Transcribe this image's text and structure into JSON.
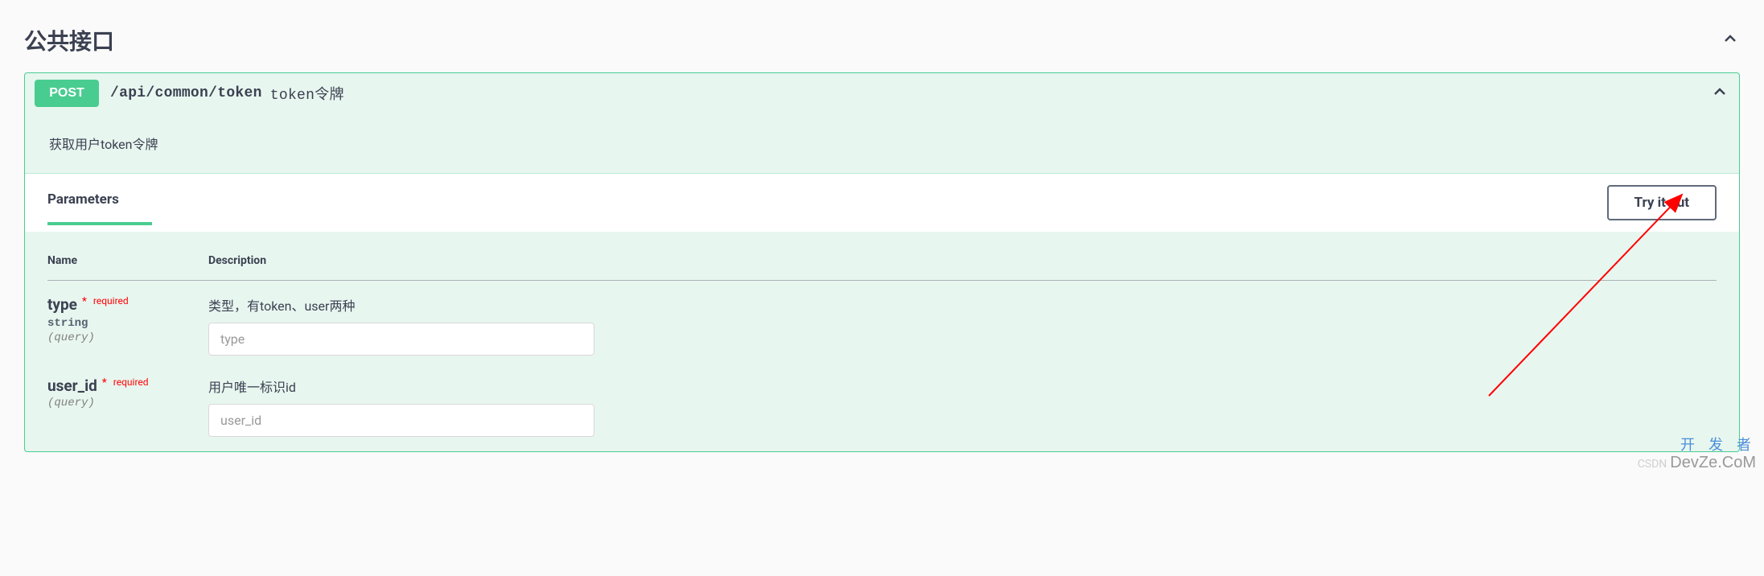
{
  "section": {
    "title": "公共接口"
  },
  "operation": {
    "method": "POST",
    "path": "/api/common/token",
    "summary": "token令牌",
    "description": "获取用户token令牌"
  },
  "paramsSection": {
    "title": "Parameters",
    "tryButton": "Try it out",
    "headers": {
      "name": "Name",
      "description": "Description"
    }
  },
  "parameters": [
    {
      "name": "type",
      "requiredLabel": "required",
      "type": "string",
      "in": "(query)",
      "description": "类型，有token、user两种",
      "placeholder": "type"
    },
    {
      "name": "user_id",
      "requiredLabel": "required",
      "type": "",
      "in": "(query)",
      "description": "用户唯一标识id",
      "placeholder": "user_id"
    }
  ],
  "watermark": {
    "line1": "开 发 者",
    "line2": "DevZe.CoM",
    "csdn": "CSDN"
  }
}
